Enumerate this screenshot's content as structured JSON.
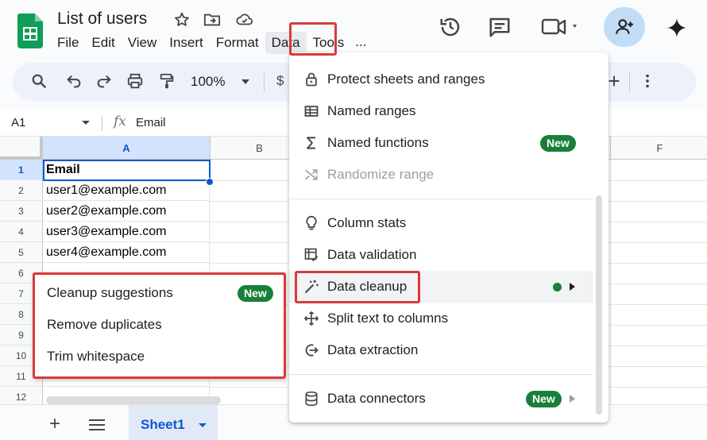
{
  "app": {
    "doc_title": "List of users"
  },
  "menubar": {
    "items": [
      "File",
      "Edit",
      "View",
      "Insert",
      "Format",
      "Data",
      "Tools"
    ],
    "more": "..."
  },
  "toolbar": {
    "zoom": "100%",
    "currency": "$"
  },
  "formula_bar": {
    "name_box": "A1",
    "fx": "fx",
    "value": "Email"
  },
  "grid": {
    "columns": [
      "A",
      "B",
      "",
      "",
      "",
      "F"
    ],
    "rows": [
      "1",
      "2",
      "3",
      "4",
      "5",
      "6",
      "7",
      "8",
      "9",
      "10",
      "11",
      "12"
    ],
    "cells_a": [
      "Email",
      "user1@example.com",
      "user2@example.com",
      "user3@example.com",
      "user4@example.com"
    ]
  },
  "sheets": {
    "add": "+",
    "active_tab": "Sheet1"
  },
  "data_menu": {
    "items": [
      {
        "label": "Protect sheets and ranges",
        "icon": "lock-icon"
      },
      {
        "label": "Named ranges",
        "icon": "table-icon"
      },
      {
        "label": "Named functions",
        "icon": "sigma-icon",
        "badge": "New"
      },
      {
        "label": "Randomize range",
        "icon": "shuffle-icon",
        "disabled": true
      },
      {
        "label": "Column stats",
        "icon": "lightbulb-icon"
      },
      {
        "label": "Data validation",
        "icon": "data-validation-icon"
      },
      {
        "label": "Data cleanup",
        "icon": "magic-wand-icon",
        "submenu": true
      },
      {
        "label": "Split text to columns",
        "icon": "split-icon"
      },
      {
        "label": "Data extraction",
        "icon": "extract-icon"
      },
      {
        "label": "Data connectors",
        "icon": "database-icon",
        "badge": "New",
        "submenu": true
      }
    ]
  },
  "cleanup_menu": {
    "items": [
      {
        "label": "Cleanup suggestions",
        "badge": "New"
      },
      {
        "label": "Remove duplicates"
      },
      {
        "label": "Trim whitespace"
      }
    ]
  },
  "colors": {
    "accent": "#0b57d0",
    "badge_green": "#188038",
    "highlight_red": "#d93a3a",
    "selected_header": "#d3e3fd"
  }
}
